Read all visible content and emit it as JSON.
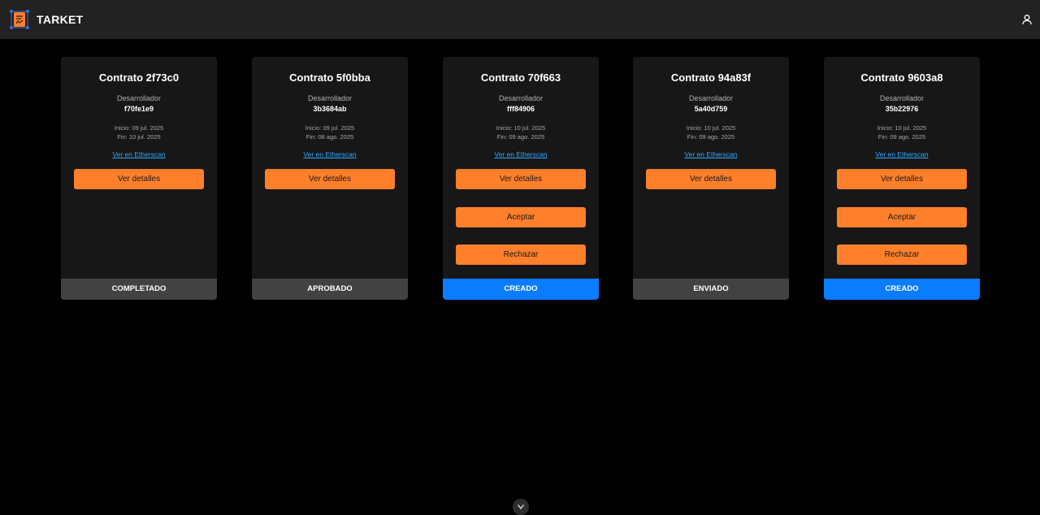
{
  "header": {
    "brand": "TARKET",
    "logo_icon": "contract-document-icon",
    "user_icon": "user-icon",
    "background": "#222222"
  },
  "colors": {
    "accent": "#ff7f2a",
    "link": "#2fa8ff",
    "status_blue": "#0a7cff",
    "status_gray": "#424242",
    "card_bg": "#171717"
  },
  "labels": {
    "developer": "Desarrollador",
    "etherscan": "Ver en Etherscan",
    "details": "Ver detalles",
    "accept": "Aceptar",
    "reject": "Rechazar"
  },
  "contracts": [
    {
      "title": "Contrato 2f73c0",
      "developer": "f70fe1e9",
      "start": "Inicio: 09 jul. 2025",
      "end": "Fin: 10 jul. 2025",
      "status": "COMPLETADO"
    },
    {
      "title": "Contrato 5f0bba",
      "developer": "3b3684ab",
      "start": "Inicio: 09 jul. 2025",
      "end": "Fin: 08 ago. 2025",
      "status": "APROBADO"
    },
    {
      "title": "Contrato 70f663",
      "developer": "fff84906",
      "start": "Inicio: 10 jul. 2025",
      "end": "Fin: 09 ago. 2025",
      "status": "CREADO"
    },
    {
      "title": "Contrato 94a83f",
      "developer": "5a40d759",
      "start": "Inicio: 10 jul. 2025",
      "end": "Fin: 09 ago. 2025",
      "status": "ENVIADO"
    },
    {
      "title": "Contrato 9603a8",
      "developer": "35b22976",
      "start": "Inicio: 10 jul. 2025",
      "end": "Fin: 09 ago. 2025",
      "status": "CREADO"
    }
  ],
  "scroll_icon": "chevron-down-icon"
}
